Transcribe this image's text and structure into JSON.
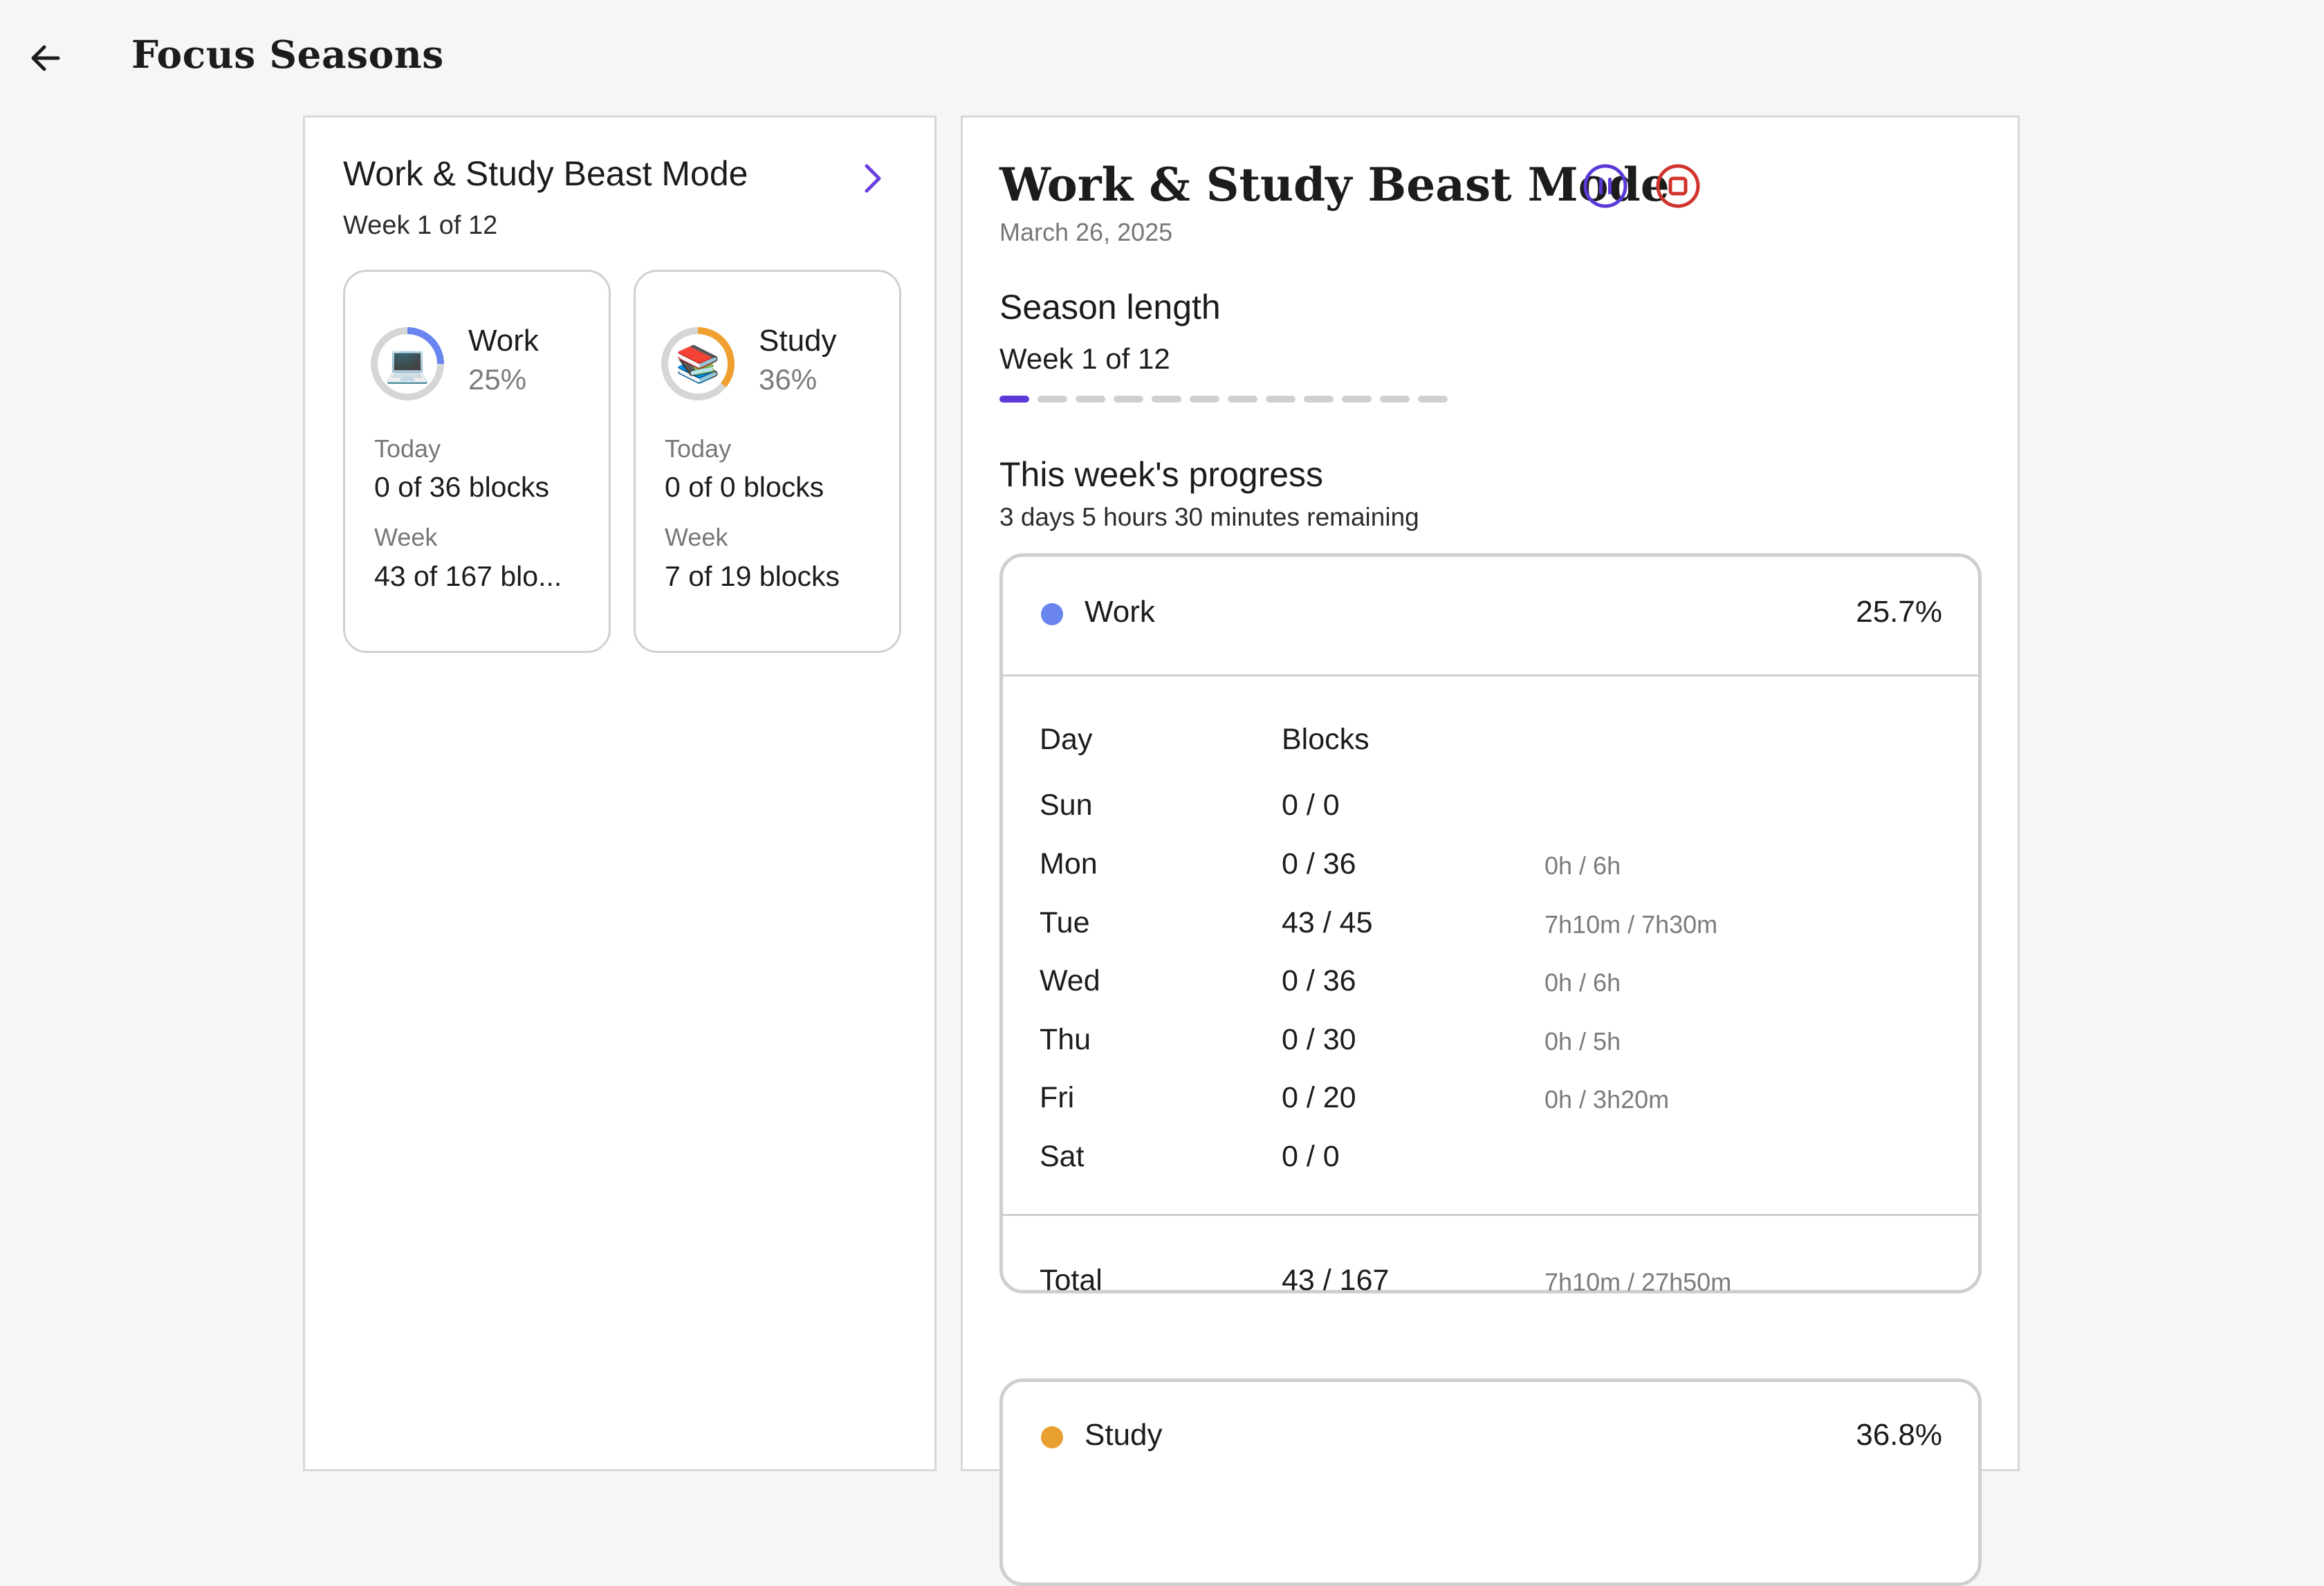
{
  "header": {
    "title": "Focus Seasons"
  },
  "season": {
    "name": "Work & Study Beast Mode",
    "week": "Week 1 of 12"
  },
  "categories": [
    {
      "name": "Work",
      "percent": "25%",
      "progress": 0.25,
      "color": "#6b85f0",
      "icon": "laptop-icon",
      "emoji": "💻",
      "today_label": "Today",
      "today_value": "0 of 36 blocks",
      "week_label": "Week",
      "week_value": "43 of 167 blo..."
    },
    {
      "name": "Study",
      "percent": "36%",
      "progress": 0.36,
      "color": "#f0a030",
      "icon": "books-icon",
      "emoji": "📚",
      "today_label": "Today",
      "today_value": "0 of 0 blocks",
      "week_label": "Week",
      "week_value": "7 of 19 blocks"
    }
  ],
  "detail": {
    "title": "Work & Study Beast Mode",
    "date": "March 26, 2025",
    "pause_icon": "pause-icon",
    "stop_icon": "stop-icon",
    "pause_color": "#5b3ad8",
    "stop_color": "#d0342c",
    "season_length_title": "Season length",
    "season_length_week": "Week 1 of 12",
    "weeks_total": 12,
    "weeks_current": 1,
    "progress_title": "This week's progress",
    "remaining": "3 days 5 hours 30 minutes remaining"
  },
  "work_table": {
    "name": "Work",
    "percent": "25.7%",
    "color": "#6b85f0",
    "col_day": "Day",
    "col_blocks": "Blocks",
    "rows": [
      {
        "day": "Sun",
        "blocks": "0 / 0",
        "time": ""
      },
      {
        "day": "Mon",
        "blocks": "0 / 36",
        "time": "0h / 6h"
      },
      {
        "day": "Tue",
        "blocks": "43 / 45",
        "time": "7h10m / 7h30m"
      },
      {
        "day": "Wed",
        "blocks": "0 / 36",
        "time": "0h / 6h"
      },
      {
        "day": "Thu",
        "blocks": "0 / 30",
        "time": "0h / 5h"
      },
      {
        "day": "Fri",
        "blocks": "0 / 20",
        "time": "0h / 3h20m"
      },
      {
        "day": "Sat",
        "blocks": "0 / 0",
        "time": ""
      }
    ],
    "total_label": "Total",
    "total_blocks": "43 / 167",
    "total_time": "7h10m / 27h50m"
  },
  "study_table": {
    "name": "Study",
    "percent": "36.8%",
    "color": "#e8a030"
  }
}
